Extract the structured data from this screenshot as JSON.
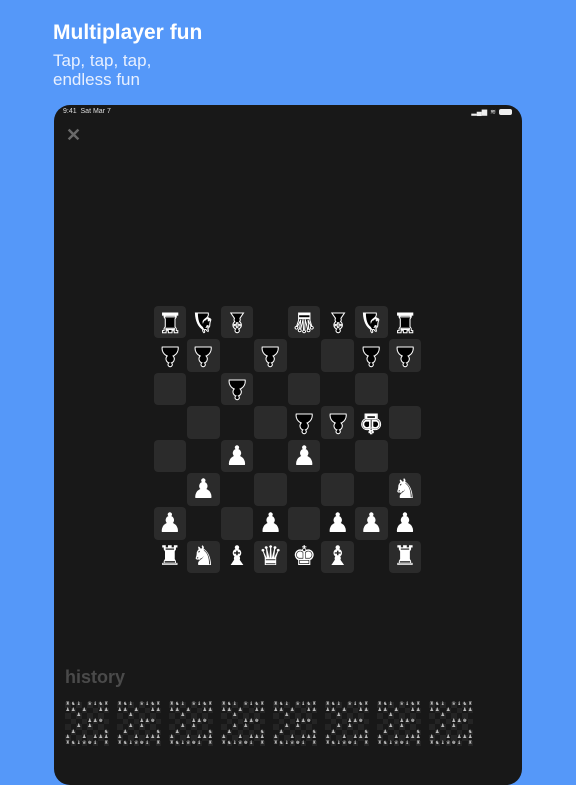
{
  "header": {
    "title": "Multiplayer fun",
    "subtitle": "Tap, tap, tap, endless fun"
  },
  "status_bar": {
    "time": "9:41",
    "date": "Sat Mar 7"
  },
  "close_icon": "close-icon",
  "board": {
    "colors": {
      "light_square": "#2b2b2b",
      "dark_square": "#181818",
      "white_piece": "#ffffff",
      "black_piece": "#000000"
    },
    "rows": [
      [
        "r",
        "n",
        "b",
        "",
        "q",
        "b",
        "n",
        "r"
      ],
      [
        "p",
        "p",
        "",
        "p",
        "",
        "",
        "p",
        "p"
      ],
      [
        "",
        "",
        "p",
        "",
        "",
        "",
        "",
        ""
      ],
      [
        "",
        "",
        "",
        "",
        "p",
        "p",
        "k",
        ""
      ],
      [
        "",
        "",
        "P",
        "",
        "P",
        "",
        "",
        ""
      ],
      [
        "",
        "P",
        "",
        "",
        "",
        "",
        "",
        "N"
      ],
      [
        "P",
        "",
        "",
        "P",
        "",
        "P",
        "P",
        "P"
      ],
      [
        "R",
        "N",
        "B",
        "Q",
        "K",
        "B",
        "",
        "R"
      ]
    ]
  },
  "history": {
    "title": "history",
    "count": 8
  }
}
